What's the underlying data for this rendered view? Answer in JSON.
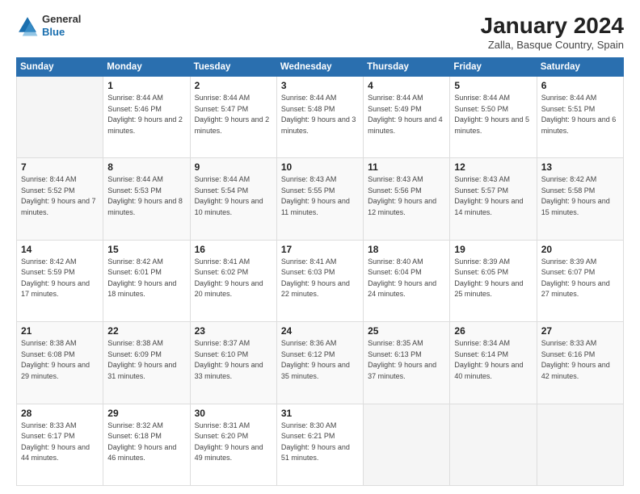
{
  "header": {
    "logo": {
      "general": "General",
      "blue": "Blue"
    },
    "title": "January 2024",
    "subtitle": "Zalla, Basque Country, Spain"
  },
  "calendar": {
    "days_of_week": [
      "Sunday",
      "Monday",
      "Tuesday",
      "Wednesday",
      "Thursday",
      "Friday",
      "Saturday"
    ],
    "weeks": [
      [
        {
          "day": "",
          "sunrise": "",
          "sunset": "",
          "daylight": ""
        },
        {
          "day": "1",
          "sunrise": "Sunrise: 8:44 AM",
          "sunset": "Sunset: 5:46 PM",
          "daylight": "Daylight: 9 hours and 2 minutes."
        },
        {
          "day": "2",
          "sunrise": "Sunrise: 8:44 AM",
          "sunset": "Sunset: 5:47 PM",
          "daylight": "Daylight: 9 hours and 2 minutes."
        },
        {
          "day": "3",
          "sunrise": "Sunrise: 8:44 AM",
          "sunset": "Sunset: 5:48 PM",
          "daylight": "Daylight: 9 hours and 3 minutes."
        },
        {
          "day": "4",
          "sunrise": "Sunrise: 8:44 AM",
          "sunset": "Sunset: 5:49 PM",
          "daylight": "Daylight: 9 hours and 4 minutes."
        },
        {
          "day": "5",
          "sunrise": "Sunrise: 8:44 AM",
          "sunset": "Sunset: 5:50 PM",
          "daylight": "Daylight: 9 hours and 5 minutes."
        },
        {
          "day": "6",
          "sunrise": "Sunrise: 8:44 AM",
          "sunset": "Sunset: 5:51 PM",
          "daylight": "Daylight: 9 hours and 6 minutes."
        }
      ],
      [
        {
          "day": "7",
          "sunrise": "Sunrise: 8:44 AM",
          "sunset": "Sunset: 5:52 PM",
          "daylight": "Daylight: 9 hours and 7 minutes."
        },
        {
          "day": "8",
          "sunrise": "Sunrise: 8:44 AM",
          "sunset": "Sunset: 5:53 PM",
          "daylight": "Daylight: 9 hours and 8 minutes."
        },
        {
          "day": "9",
          "sunrise": "Sunrise: 8:44 AM",
          "sunset": "Sunset: 5:54 PM",
          "daylight": "Daylight: 9 hours and 10 minutes."
        },
        {
          "day": "10",
          "sunrise": "Sunrise: 8:43 AM",
          "sunset": "Sunset: 5:55 PM",
          "daylight": "Daylight: 9 hours and 11 minutes."
        },
        {
          "day": "11",
          "sunrise": "Sunrise: 8:43 AM",
          "sunset": "Sunset: 5:56 PM",
          "daylight": "Daylight: 9 hours and 12 minutes."
        },
        {
          "day": "12",
          "sunrise": "Sunrise: 8:43 AM",
          "sunset": "Sunset: 5:57 PM",
          "daylight": "Daylight: 9 hours and 14 minutes."
        },
        {
          "day": "13",
          "sunrise": "Sunrise: 8:42 AM",
          "sunset": "Sunset: 5:58 PM",
          "daylight": "Daylight: 9 hours and 15 minutes."
        }
      ],
      [
        {
          "day": "14",
          "sunrise": "Sunrise: 8:42 AM",
          "sunset": "Sunset: 5:59 PM",
          "daylight": "Daylight: 9 hours and 17 minutes."
        },
        {
          "day": "15",
          "sunrise": "Sunrise: 8:42 AM",
          "sunset": "Sunset: 6:01 PM",
          "daylight": "Daylight: 9 hours and 18 minutes."
        },
        {
          "day": "16",
          "sunrise": "Sunrise: 8:41 AM",
          "sunset": "Sunset: 6:02 PM",
          "daylight": "Daylight: 9 hours and 20 minutes."
        },
        {
          "day": "17",
          "sunrise": "Sunrise: 8:41 AM",
          "sunset": "Sunset: 6:03 PM",
          "daylight": "Daylight: 9 hours and 22 minutes."
        },
        {
          "day": "18",
          "sunrise": "Sunrise: 8:40 AM",
          "sunset": "Sunset: 6:04 PM",
          "daylight": "Daylight: 9 hours and 24 minutes."
        },
        {
          "day": "19",
          "sunrise": "Sunrise: 8:39 AM",
          "sunset": "Sunset: 6:05 PM",
          "daylight": "Daylight: 9 hours and 25 minutes."
        },
        {
          "day": "20",
          "sunrise": "Sunrise: 8:39 AM",
          "sunset": "Sunset: 6:07 PM",
          "daylight": "Daylight: 9 hours and 27 minutes."
        }
      ],
      [
        {
          "day": "21",
          "sunrise": "Sunrise: 8:38 AM",
          "sunset": "Sunset: 6:08 PM",
          "daylight": "Daylight: 9 hours and 29 minutes."
        },
        {
          "day": "22",
          "sunrise": "Sunrise: 8:38 AM",
          "sunset": "Sunset: 6:09 PM",
          "daylight": "Daylight: 9 hours and 31 minutes."
        },
        {
          "day": "23",
          "sunrise": "Sunrise: 8:37 AM",
          "sunset": "Sunset: 6:10 PM",
          "daylight": "Daylight: 9 hours and 33 minutes."
        },
        {
          "day": "24",
          "sunrise": "Sunrise: 8:36 AM",
          "sunset": "Sunset: 6:12 PM",
          "daylight": "Daylight: 9 hours and 35 minutes."
        },
        {
          "day": "25",
          "sunrise": "Sunrise: 8:35 AM",
          "sunset": "Sunset: 6:13 PM",
          "daylight": "Daylight: 9 hours and 37 minutes."
        },
        {
          "day": "26",
          "sunrise": "Sunrise: 8:34 AM",
          "sunset": "Sunset: 6:14 PM",
          "daylight": "Daylight: 9 hours and 40 minutes."
        },
        {
          "day": "27",
          "sunrise": "Sunrise: 8:33 AM",
          "sunset": "Sunset: 6:16 PM",
          "daylight": "Daylight: 9 hours and 42 minutes."
        }
      ],
      [
        {
          "day": "28",
          "sunrise": "Sunrise: 8:33 AM",
          "sunset": "Sunset: 6:17 PM",
          "daylight": "Daylight: 9 hours and 44 minutes."
        },
        {
          "day": "29",
          "sunrise": "Sunrise: 8:32 AM",
          "sunset": "Sunset: 6:18 PM",
          "daylight": "Daylight: 9 hours and 46 minutes."
        },
        {
          "day": "30",
          "sunrise": "Sunrise: 8:31 AM",
          "sunset": "Sunset: 6:20 PM",
          "daylight": "Daylight: 9 hours and 49 minutes."
        },
        {
          "day": "31",
          "sunrise": "Sunrise: 8:30 AM",
          "sunset": "Sunset: 6:21 PM",
          "daylight": "Daylight: 9 hours and 51 minutes."
        },
        {
          "day": "",
          "sunrise": "",
          "sunset": "",
          "daylight": ""
        },
        {
          "day": "",
          "sunrise": "",
          "sunset": "",
          "daylight": ""
        },
        {
          "day": "",
          "sunrise": "",
          "sunset": "",
          "daylight": ""
        }
      ]
    ]
  }
}
